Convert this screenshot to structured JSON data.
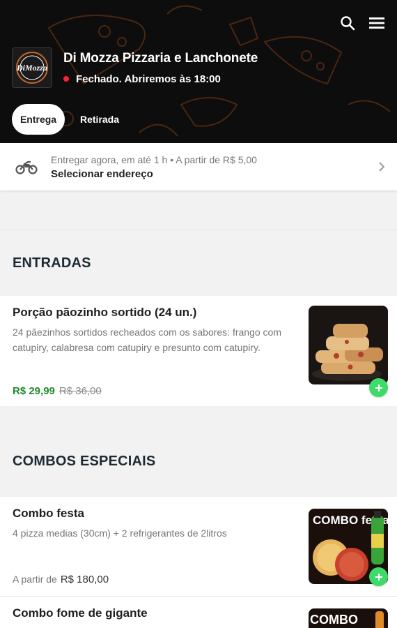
{
  "header": {
    "store_name": "Di Mozza Pizzaria e Lanchonete",
    "status": "Fechado. Abriremos às 18:00",
    "logo_text": "DiMozza",
    "status_color": "#ff1f3d",
    "tabs": [
      {
        "label": "Entrega",
        "active": true
      },
      {
        "label": "Retirada",
        "active": false
      }
    ],
    "icons": [
      "search-icon",
      "menu-icon"
    ]
  },
  "delivery": {
    "info": "Entregar agora, em até 1 h  •  A partir de R$ 5,00",
    "address_label": "Selecionar endereço",
    "icon": "motorcycle-icon"
  },
  "sections": [
    {
      "title": "ENTRADAS",
      "products": [
        {
          "name": "Porção pãozinho sortido (24 un.)",
          "description": "24 pãezinhos sortidos recheados com os sabores: frango com catupiry, calabresa com catupiry e presunto com catupiry.",
          "price": "R$ 29,99",
          "old_price": "R$ 36,00"
        }
      ]
    },
    {
      "title": "COMBOS ESPECIAIS",
      "products": [
        {
          "name": "Combo festa",
          "description": "4 pizza medias (30cm) + 2 refrigerantes de 2litros",
          "price_prefix": "A partir de",
          "price": "R$ 180,00",
          "image_text": "COMBO festa"
        },
        {
          "name": "Combo fome de gigante",
          "image_text": "COMBO"
        }
      ]
    }
  ],
  "colors": {
    "accent_green": "#3ddc6a",
    "price_green": "#1f8a2c",
    "header_bg": "#0d0d0d"
  }
}
